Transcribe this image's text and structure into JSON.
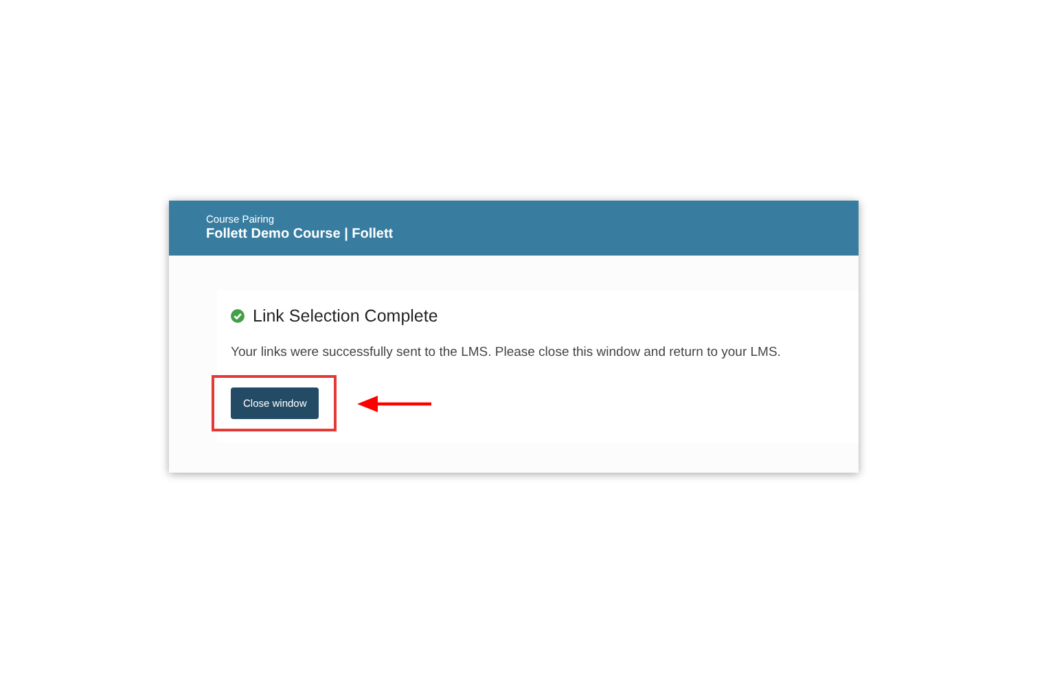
{
  "header": {
    "subtitle": "Course Pairing",
    "title": "Follett Demo Course | Follett"
  },
  "message": {
    "success": true,
    "heading": "Link Selection Complete",
    "text": "Your links were successfully sent to the LMS. Please close this window and return to your LMS."
  },
  "button": {
    "label": "Close window",
    "highlighted": true
  }
}
